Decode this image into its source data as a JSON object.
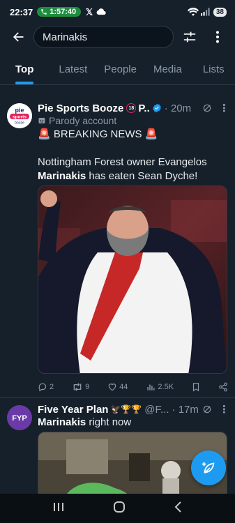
{
  "status_bar": {
    "time": "22:37",
    "call_timer": "1:57:40",
    "battery": "38"
  },
  "search": {
    "query": "Marinakis"
  },
  "tabs": [
    {
      "label": "Top",
      "active": true
    },
    {
      "label": "Latest",
      "active": false
    },
    {
      "label": "People",
      "active": false
    },
    {
      "label": "Media",
      "active": false
    },
    {
      "label": "Lists",
      "active": false
    }
  ],
  "tweets": [
    {
      "display_name": "Pie Sports Booze",
      "name_badge": "18",
      "name_tail": "P..",
      "time": "20m",
      "label": "Parody account",
      "line1": "BREAKING NEWS",
      "line2_pre": "Nottingham Forest owner Evangelos ",
      "line2_bold": "Marinakis",
      "line2_post": " has eaten Sean Dyche!",
      "avatar_text_top": "pie",
      "avatar_text_mid": "sports",
      "avatar_text_bot": "booze",
      "stats": {
        "replies": "2",
        "reposts": "9",
        "likes": "44",
        "views": "2.5K"
      }
    },
    {
      "display_name": "Five Year Plan",
      "handle": "@F...",
      "time": "17m",
      "text_bold": "Marinakis",
      "text_rest": " right now",
      "avatar_text": "FYP"
    }
  ],
  "colors": {
    "accent": "#1d9bf0",
    "background": "#15202b",
    "muted": "#8b98a5",
    "border": "#2f3b46",
    "call_green": "#1e8e3e"
  }
}
